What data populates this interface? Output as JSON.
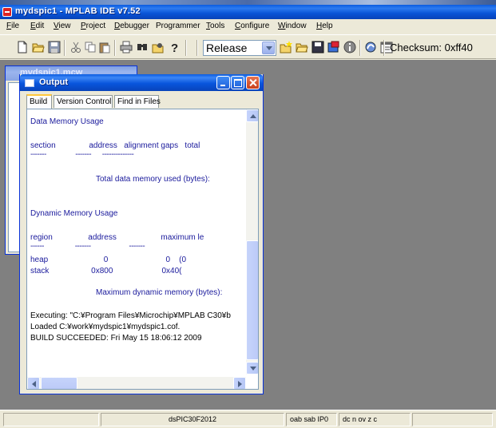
{
  "window": {
    "title": "mydspic1 - MPLAB IDE v7.52"
  },
  "menu": [
    {
      "label": "File",
      "accel": "F",
      "rest": "ile"
    },
    {
      "label": "Edit",
      "accel": "E",
      "rest": "dit"
    },
    {
      "label": "View",
      "accel": "V",
      "rest": "iew"
    },
    {
      "label": "Project",
      "accel": "P",
      "rest": "roject"
    },
    {
      "label": "Debugger",
      "accel": "D",
      "rest": "ebugger"
    },
    {
      "label": "Programmer",
      "accel": "",
      "rest": "Programmer"
    },
    {
      "label": "Tools",
      "accel": "T",
      "rest": "ools"
    },
    {
      "label": "Configure",
      "accel": "C",
      "rest": "onfigure"
    },
    {
      "label": "Window",
      "accel": "W",
      "rest": "indow"
    },
    {
      "label": "Help",
      "accel": "H",
      "rest": "elp"
    }
  ],
  "toolbar": {
    "build_config": "Release",
    "checksum": "Checksum:  0xff40",
    "icons": [
      "new-file-icon",
      "open-folder-icon",
      "save-icon",
      "cut-icon",
      "copy-icon",
      "paste-icon",
      "print-icon",
      "find-icon",
      "find-in-files-icon",
      "help-icon",
      "new-project-icon",
      "open-project-icon",
      "save-project-icon",
      "project-wizard-icon",
      "info-icon",
      "build-all-icon",
      "calendar-icon"
    ]
  },
  "background_window": {
    "title": "mydspic1.mcw"
  },
  "output": {
    "title": "Output",
    "tabs": [
      "Build",
      "Version Control",
      "Find in Files"
    ],
    "active_tab": "Build",
    "lines": [
      {
        "text": "Data Memory Usage"
      },
      {
        "text": "section               address   alignment gaps   total"
      },
      {
        "text": "-------                -------      --------------"
      },
      {
        "text": "Total data memory used (bytes):"
      },
      {
        "text": "Dynamic Memory Usage"
      },
      {
        "text": "region                address                    maximum le"
      },
      {
        "text": "------                 -------                     -------"
      },
      {
        "text": "heap                         0                          0    (0"
      },
      {
        "text": "stack                   0x800                      0x40("
      },
      {
        "text": "Maximum dynamic memory (bytes):"
      },
      {
        "text": "Executing: \"C:¥Program Files¥Microchip¥MPLAB C30¥b"
      },
      {
        "text": "Loaded C:¥work¥mydspic1¥mydspic1.cof."
      },
      {
        "text": "BUILD SUCCEEDED: Fri May 15 18:06:12 2009"
      }
    ]
  },
  "status": {
    "device": "dsPIC30F2012",
    "registers": "oab sab IP0",
    "flags": "dc n ov z c"
  },
  "colors": {
    "output_text": "#1a1a9c",
    "title_blue": "#0a5ce0",
    "workspace": "#808080"
  }
}
